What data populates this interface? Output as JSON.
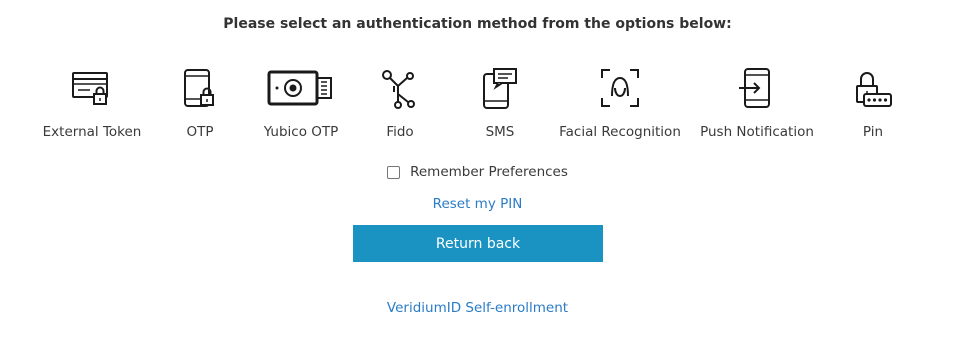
{
  "heading": "Please select an authentication method from the options below:",
  "methods": [
    {
      "label": "External Token",
      "icon": "external-token-icon"
    },
    {
      "label": "OTP",
      "icon": "otp-icon"
    },
    {
      "label": "Yubico OTP",
      "icon": "yubico-key-icon"
    },
    {
      "label": "Fido",
      "icon": "fido-icon"
    },
    {
      "label": "SMS",
      "icon": "sms-icon"
    },
    {
      "label": "Facial Recognition",
      "icon": "face-scan-icon"
    },
    {
      "label": "Push Notification",
      "icon": "push-notification-icon"
    },
    {
      "label": "Pin",
      "icon": "pin-lock-icon"
    }
  ],
  "remember": {
    "label": "Remember Preferences",
    "checked": false
  },
  "links": {
    "reset_pin": "Reset my PIN",
    "self_enrollment": "VeridiumID Self-enrollment"
  },
  "buttons": {
    "return_back": "Return back"
  },
  "colors": {
    "primary_button": "#1a93c2",
    "link": "#2a7cc7",
    "text": "#3a3a3a"
  }
}
